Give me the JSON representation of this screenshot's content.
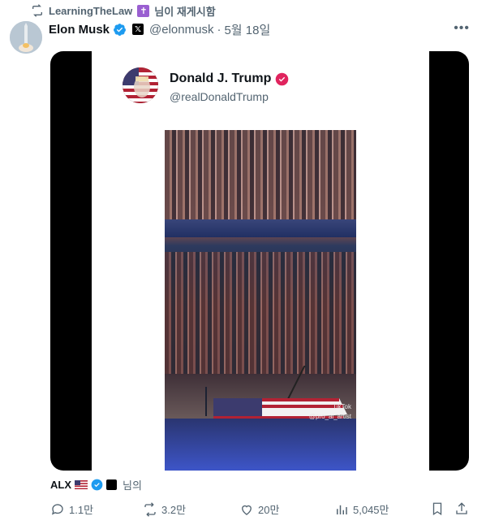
{
  "repost": {
    "user": "LearningTheLaw",
    "emoji": "✝",
    "suffix": "님이 재게시함"
  },
  "author": {
    "name": "Elon Musk",
    "handle": "@elonmusk",
    "separator": "·",
    "date": "5월 18일"
  },
  "media": {
    "embedded_tweet": {
      "name": "Donald J. Trump",
      "handle": "@realDonaldTrump"
    },
    "watermark_brand": "TikTok",
    "watermark_user": "@pro_ai_artist"
  },
  "retweeted_by": {
    "name": "ALX",
    "suffix": "님의"
  },
  "actions": {
    "replies": "1.1만",
    "reposts": "3.2만",
    "likes": "20만",
    "views": "5,045만"
  },
  "colors": {
    "accent_blue": "#1d9bf0",
    "muted_text": "#536471",
    "verified_pink": "#e0245e"
  }
}
